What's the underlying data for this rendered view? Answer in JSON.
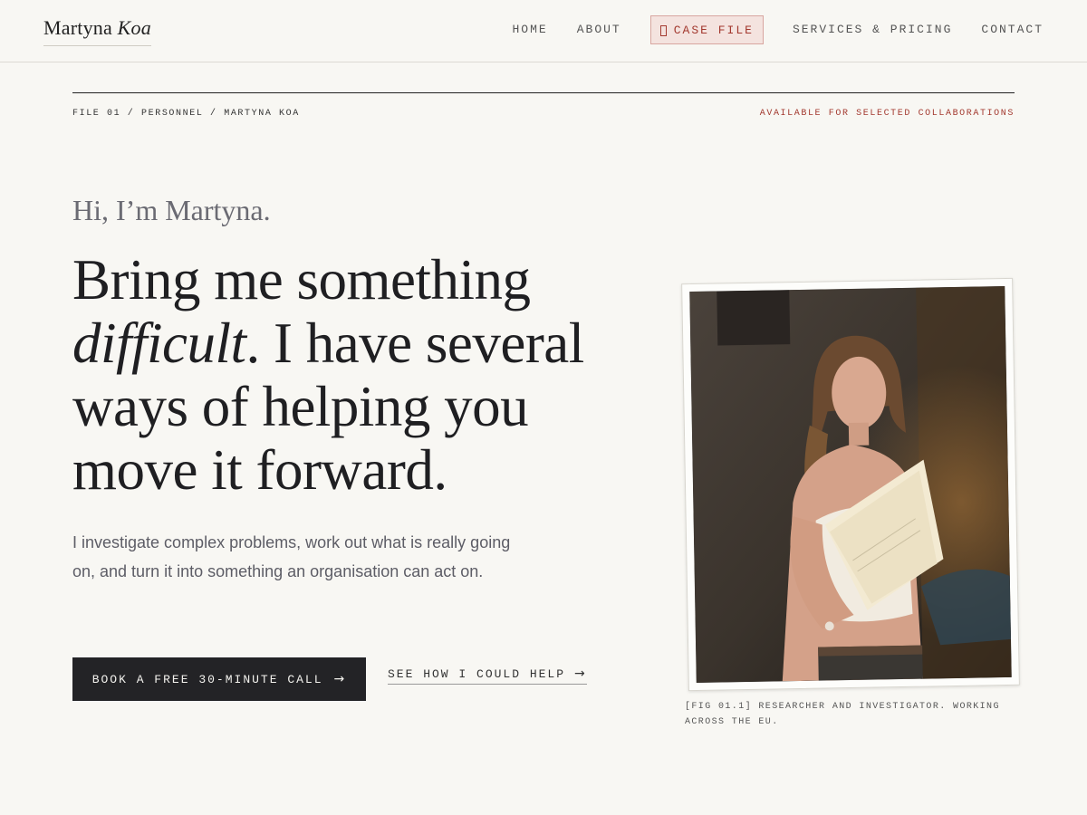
{
  "header": {
    "logo_first": "Martyna",
    "logo_last": "Koa",
    "nav": [
      {
        "label": "HOME"
      },
      {
        "label": "ABOUT"
      },
      {
        "label": "CASE FILE",
        "active": true,
        "icon": "folder-icon"
      },
      {
        "label": "SERVICES & PRICING"
      },
      {
        "label": "CONTACT"
      }
    ]
  },
  "meta": {
    "breadcrumb": "FILE 01 / PERSONNEL / MARTYNA KOA",
    "availability": "AVAILABLE FOR SELECTED COLLABORATIONS"
  },
  "hero": {
    "greeting": "Hi, I’m Martyna.",
    "headline_part1": "Bring me something",
    "headline_em": "difficult",
    "headline_part2": ". I have several ways of helping you move it forward.",
    "intro": "I investigate complex problems, work out what is really going on, and turn it into something an organisation can act on.",
    "cta_primary": "BOOK A FREE 30-MINUTE CALL",
    "cta_secondary": "SEE HOW I COULD HELP",
    "arrow_icon": "→"
  },
  "figure": {
    "caption": "[FIG 01.1] RESEARCHER AND INVESTIGATOR. WORKING ACROSS THE EU."
  },
  "colors": {
    "background": "#f8f7f3",
    "accent": "#a3392f",
    "button_dark": "#232326"
  }
}
